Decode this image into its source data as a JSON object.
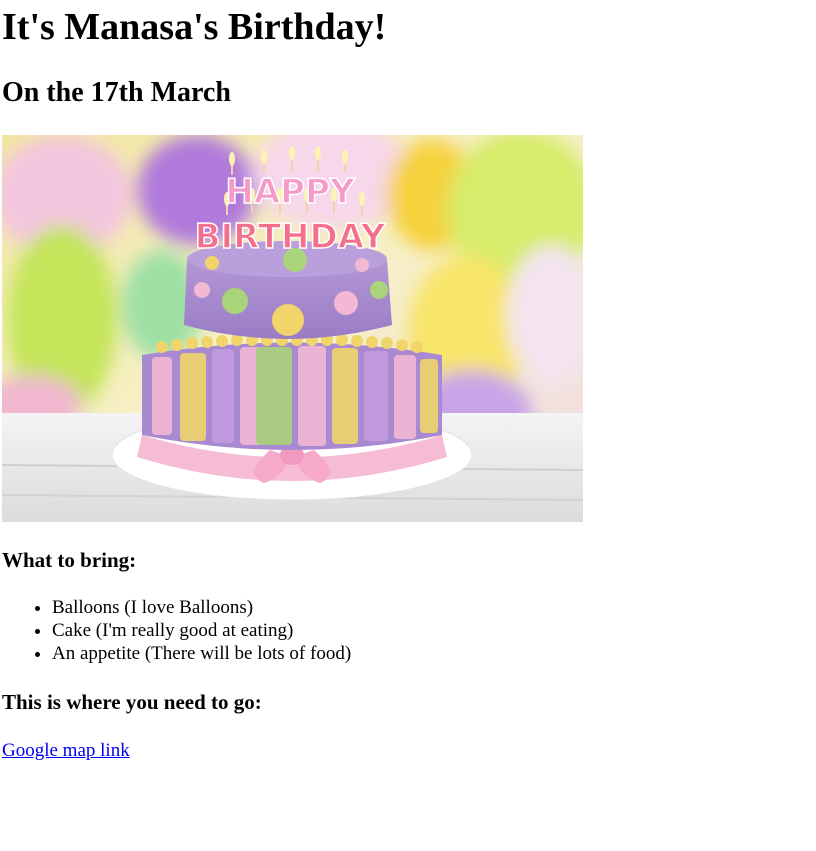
{
  "heading": "It's Manasa's Birthday!",
  "date_line": "On the 17th March",
  "image": {
    "cake_text_top": "HAPPY",
    "cake_text_bottom": "BIRTHDAY"
  },
  "bring": {
    "heading": "What to bring:",
    "items": [
      "Balloons (I love Balloons)",
      "Cake (I'm really good at eating)",
      "An appetite (There will be lots of food)"
    ]
  },
  "location": {
    "heading": "This is where you need to go:",
    "link_text": "Google map link"
  }
}
